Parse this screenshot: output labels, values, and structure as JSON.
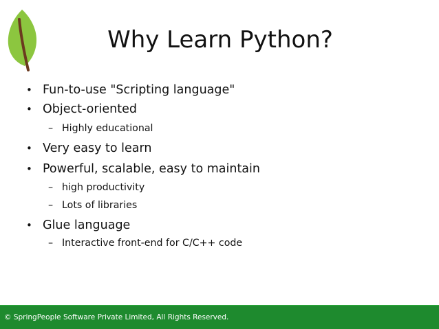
{
  "slide": {
    "title": "Why Learn Python?",
    "logo_icon": "leaf-icon",
    "bullet_glyph": "•",
    "dash_glyph": "–",
    "bullets": [
      {
        "text": "Fun-to-use \"Scripting language\""
      },
      {
        "text": "Object-oriented",
        "sub": [
          "Highly educational"
        ]
      },
      {
        "text": "Very easy to learn"
      },
      {
        "text": "Powerful, scalable, easy to maintain",
        "sub": [
          "high productivity",
          "Lots of libraries"
        ]
      },
      {
        "text": "Glue language",
        "sub": [
          "Interactive front-end for C/C++ code"
        ]
      }
    ]
  },
  "footer": {
    "text": "© SpringPeople Software Private Limited, All Rights Reserved."
  },
  "colors": {
    "footer_bg": "#1e8a2e",
    "leaf_green": "#8cc63f",
    "leaf_stem": "#6b3a1f"
  }
}
